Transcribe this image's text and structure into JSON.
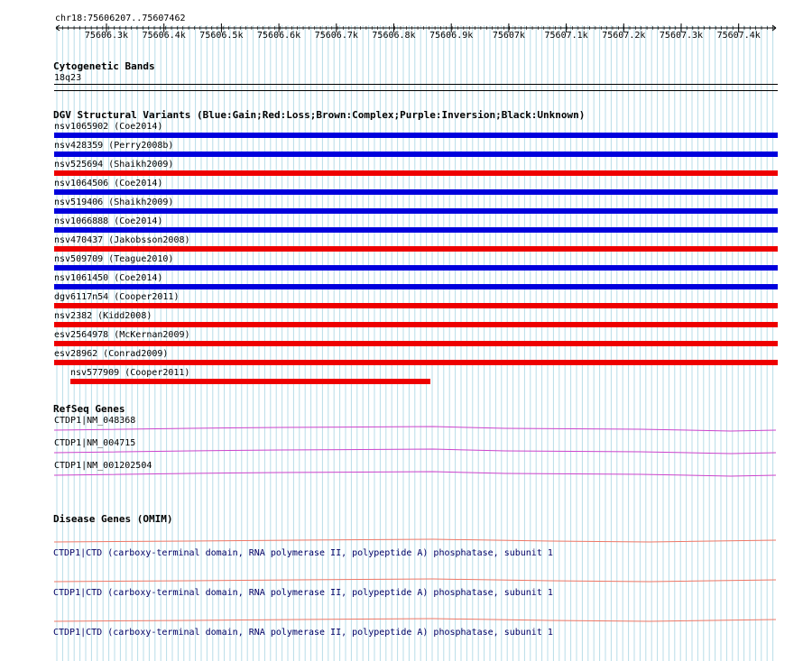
{
  "coordinates": "chr18:75606207..75607462",
  "ruler_ticks": [
    "75606.3k",
    "75606.4k",
    "75606.5k",
    "75606.6k",
    "75606.7k",
    "75606.8k",
    "75606.9k",
    "75607k",
    "75607.1k",
    "75607.2k",
    "75607.3k",
    "75607.4k"
  ],
  "cytoband": {
    "title": "Cytogenetic Bands",
    "band": "18q23"
  },
  "dgv": {
    "title": "DGV Structural Variants (Blue:Gain;Red:Loss;Brown:Complex;Purple:Inversion;Black:Unknown)",
    "items": [
      {
        "label": "nsv1065902 (Coe2014)",
        "type": "gain"
      },
      {
        "label": "nsv428359 (Perry2008b)",
        "type": "gain"
      },
      {
        "label": "nsv525694 (Shaikh2009)",
        "type": "loss"
      },
      {
        "label": "nsv1064506 (Coe2014)",
        "type": "gain"
      },
      {
        "label": "nsv519406 (Shaikh2009)",
        "type": "gain"
      },
      {
        "label": "nsv1066888 (Coe2014)",
        "type": "gain"
      },
      {
        "label": "nsv470437 (Jakobsson2008)",
        "type": "loss"
      },
      {
        "label": "nsv509709 (Teague2010)",
        "type": "gain"
      },
      {
        "label": "nsv1061450 (Coe2014)",
        "type": "gain"
      },
      {
        "label": "dgv6117n54 (Cooper2011)",
        "type": "loss"
      },
      {
        "label": "nsv2382 (Kidd2008)",
        "type": "loss"
      },
      {
        "label": "esv2564978 (McKernan2009)",
        "type": "loss"
      },
      {
        "label": "esv28962 (Conrad2009)",
        "type": "loss"
      },
      {
        "label": "nsv577909 (Cooper2011)",
        "type": "loss"
      }
    ]
  },
  "refseq": {
    "title": "RefSeq Genes",
    "items": [
      "CTDP1|NM_048368",
      "CTDP1|NM_004715",
      "CTDP1|NM_001202504"
    ]
  },
  "omim": {
    "title": "Disease Genes (OMIM)",
    "items": [
      "CTDP1|CTD (carboxy-terminal domain, RNA polymerase II, polypeptide A) phosphatase, subunit 1",
      "CTDP1|CTD (carboxy-terminal domain, RNA polymerase II, polypeptide A) phosphatase, subunit 1",
      "CTDP1|CTD (carboxy-terminal domain, RNA polymerase II, polypeptide A) phosphatase, subunit 1"
    ]
  },
  "colors": {
    "gain": "#0000dd",
    "loss": "#ee0000",
    "refseq": "#cc44cc",
    "omim": "#ee7766",
    "grid": "#b8dde8"
  }
}
